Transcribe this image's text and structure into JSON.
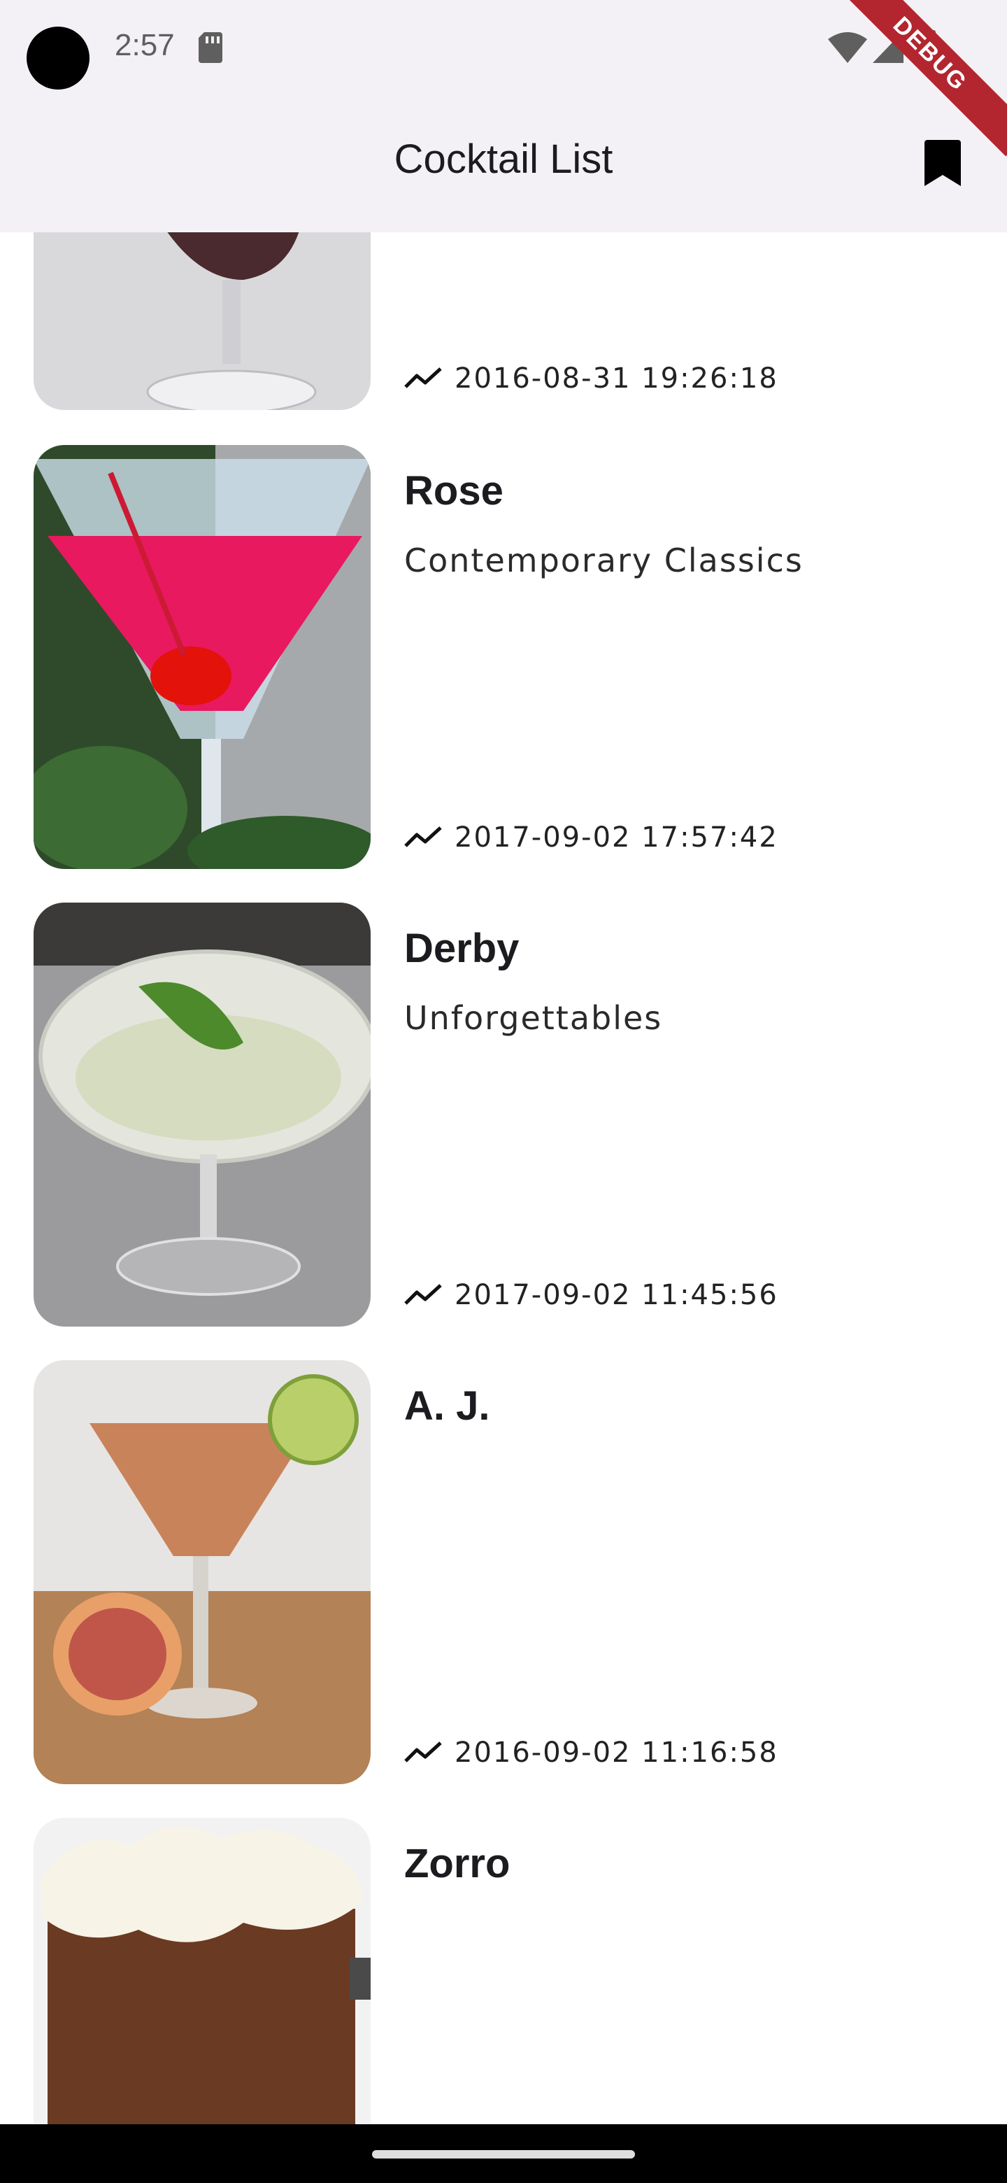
{
  "status_bar": {
    "time": "2:57"
  },
  "debug_banner": "DEBUG",
  "app_bar": {
    "title": "Cocktail List"
  },
  "cocktails": [
    {
      "name": "",
      "category": "",
      "date": "2016-08-31 19:26:18"
    },
    {
      "name": "Rose",
      "category": "Contemporary Classics",
      "date": "2017-09-02 17:57:42"
    },
    {
      "name": "Derby",
      "category": "Unforgettables",
      "date": "2017-09-02 11:45:56"
    },
    {
      "name": "A. J.",
      "category": "",
      "date": "2016-09-02 11:16:58"
    },
    {
      "name": "Zorro",
      "category": "",
      "date": ""
    }
  ]
}
